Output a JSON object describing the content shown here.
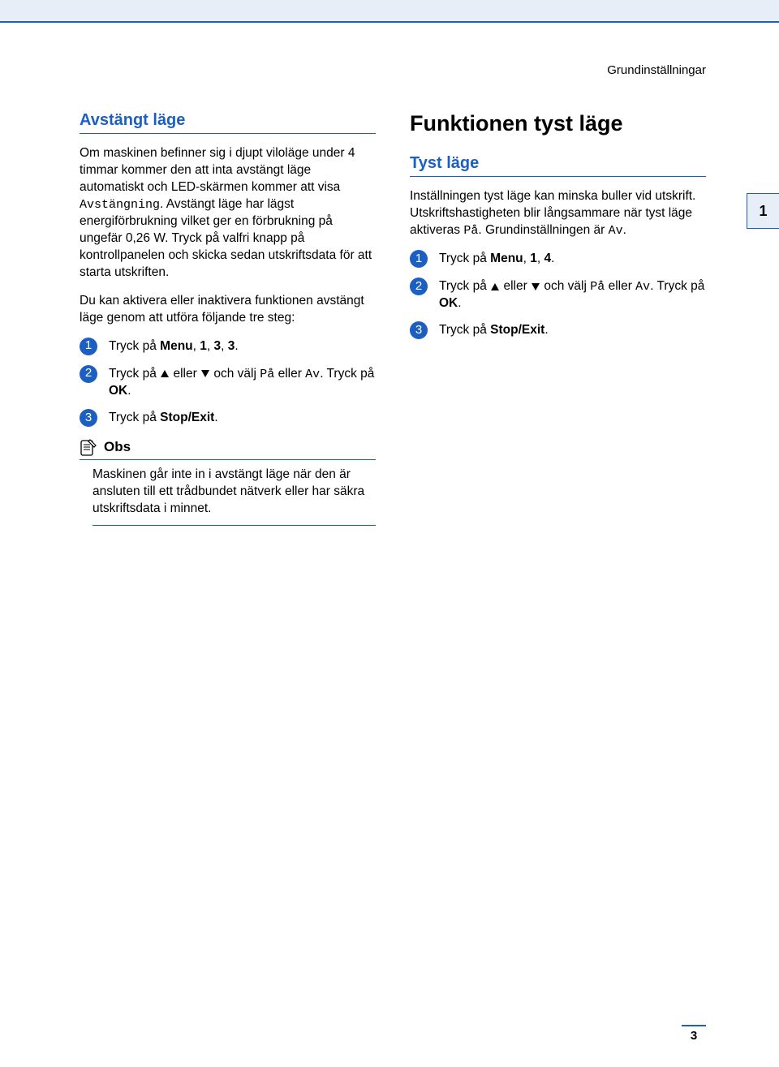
{
  "header": {
    "topright": "Grundinställningar"
  },
  "left": {
    "heading": "Avstängt läge",
    "para1_a": "Om maskinen befinner sig i djupt viloläge under 4 timmar kommer den att inta avstängt läge automatiskt och LED-skärmen kommer att visa ",
    "para1_mono": "Avstängning",
    "para1_b": ". Avstängt läge har lägst energiförbrukning vilket ger en förbrukning på ungefär 0,26 W. Tryck på valfri knapp på kontrollpanelen och skicka sedan utskriftsdata för att starta utskriften.",
    "para2": "Du kan aktivera eller inaktivera funktionen avstängt läge genom att utföra följande tre steg:",
    "step1_a": "Tryck på ",
    "step1_b": "Menu",
    "step1_c": ", ",
    "step1_d": "1",
    "step1_e": ", ",
    "step1_f": "3",
    "step1_g": ", ",
    "step1_h": "3",
    "step1_i": ".",
    "step2_a": "Tryck på ",
    "step2_b": " eller ",
    "step2_c": " och välj ",
    "step2_on": "På",
    "step2_d": " eller ",
    "step2_off": "Av",
    "step2_e": ". Tryck på ",
    "step2_ok": "OK",
    "step2_f": ".",
    "step3_a": "Tryck på ",
    "step3_b": "Stop/Exit",
    "step3_c": ".",
    "note_title": "Obs",
    "note_body": "Maskinen går inte in i avstängt läge när den är ansluten till ett trådbundet nätverk eller har säkra utskriftsdata i minnet."
  },
  "right": {
    "main_heading": "Funktionen tyst läge",
    "sub_heading": "Tyst läge",
    "para_a": "Inställningen tyst läge kan minska buller vid utskrift. Utskriftshastigheten blir långsammare när tyst läge aktiveras ",
    "para_on": "På",
    "para_b": ". Grundinställningen är ",
    "para_off": "Av",
    "para_c": ".",
    "step1_a": "Tryck på ",
    "step1_b": "Menu",
    "step1_c": ", ",
    "step1_d": "1",
    "step1_e": ", ",
    "step1_f": "4",
    "step1_g": ".",
    "step2_a": "Tryck på ",
    "step2_b": " eller ",
    "step2_c": " och välj ",
    "step2_on": "På",
    "step2_d": " eller ",
    "step2_off": "Av",
    "step2_e": ". Tryck på ",
    "step2_ok": "OK",
    "step2_f": ".",
    "step3_a": "Tryck på ",
    "step3_b": "Stop/Exit",
    "step3_c": "."
  },
  "sidetab": "1",
  "pagenum": "3",
  "nums": {
    "n1": "1",
    "n2": "2",
    "n3": "3"
  }
}
